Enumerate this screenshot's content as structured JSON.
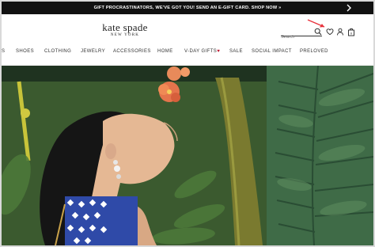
{
  "promo": {
    "text": "GIFT PROCRASTINATORS, WE'VE GOT YOU! SEND AN E-GIFT CARD. SHOP NOW »"
  },
  "brand": {
    "name": "kate spade",
    "sub": "NEW YORK"
  },
  "search": {
    "placeholder": "Search"
  },
  "nav": {
    "items": [
      "S",
      "SHOES",
      "CLOTHING",
      "JEWELRY",
      "ACCESSORIES",
      "HOME",
      "V-DAY GIFTS",
      "SALE",
      "SOCIAL IMPACT",
      "PRELOVED"
    ]
  },
  "colors": {
    "promo_bg": "#111111",
    "vday_heart": "#c0152f",
    "annotation_arrow": "#e8323c"
  },
  "icons": [
    "chevron-left-icon",
    "chevron-right-icon",
    "search-icon",
    "heart-icon",
    "user-icon",
    "shopping-bag-icon"
  ]
}
